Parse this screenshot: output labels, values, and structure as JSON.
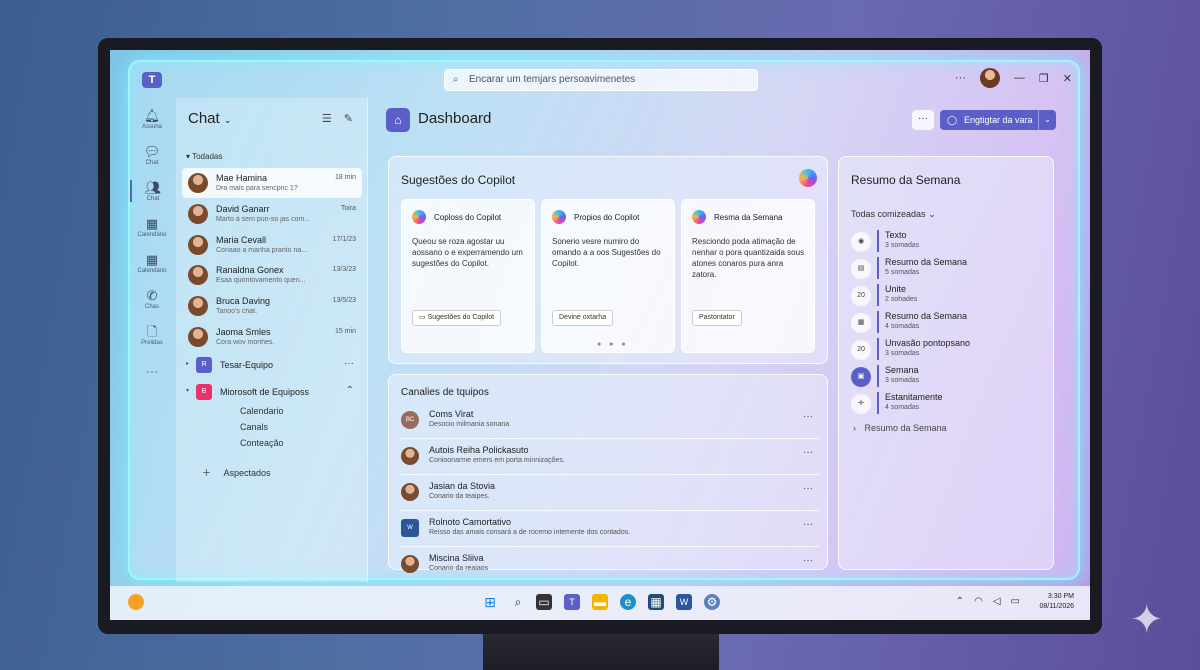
{
  "titlebar": {
    "search_placeholder": "Encarar um temjars persoavimenetes",
    "more_label": "···",
    "window_controls": [
      "minimize-icon",
      "restore-icon",
      "close-icon"
    ]
  },
  "rail": [
    {
      "label": "Assuna",
      "icon": "bell-icon"
    },
    {
      "label": "Chat",
      "icon": "chat-icon"
    },
    {
      "label": "Chat",
      "icon": "teams-icon",
      "active": true
    },
    {
      "label": "Calendário",
      "icon": "calendar-icon"
    },
    {
      "label": "Calendário",
      "icon": "calendar-icon"
    },
    {
      "label": "Chas",
      "icon": "phone-icon"
    },
    {
      "label": "Prelidas",
      "icon": "file-icon"
    }
  ],
  "chat": {
    "title": "Chat",
    "section": "Todadas",
    "items": [
      {
        "name": "Mae Hamina",
        "preview": "Dra mals para sencpnc 1?",
        "time": "18 min"
      },
      {
        "name": "David Ganarr",
        "preview": "Marto à sem pun-so jas com...",
        "time": "Toira"
      },
      {
        "name": "Maria Cevall",
        "preview": "Conaao a manha pranto na...",
        "time": "17/1/23"
      },
      {
        "name": "Ranaldna Gonex",
        "preview": "Esaa quontovamento quen...",
        "time": "13/3/23"
      },
      {
        "name": "Bruca Daving",
        "preview": "Tanoo's chat.",
        "time": "13/5/23"
      },
      {
        "name": "Jaoma Smles",
        "preview": "Cora wov monhes.",
        "time": "15 min"
      }
    ],
    "teams": [
      {
        "initial": "R",
        "name": "Tesar-Equipo",
        "color": "#5b5fc7"
      },
      {
        "initial": "B",
        "name": "Miorosoft de Equiposs",
        "color": "#e8336a"
      }
    ],
    "sub_items": [
      "Calendario",
      "Canals",
      "Conteação"
    ],
    "add_label": "Aspectados"
  },
  "dashboard": {
    "title": "Dashboard",
    "meet_label": "Engtigtar da vara",
    "copilot": {
      "title": "Sugestões do Copilot",
      "cards": [
        {
          "title": "Coploss do Copilot",
          "body": "Queou se roza agostar uu aossano o e experramendo um sugestões do Copilot.",
          "button": "Sugestões do Copilot"
        },
        {
          "title": "Propios do Copilot",
          "body": "Sonerio vesre numiro do omando a a oos Sugestões do Copilot.",
          "button": "Devine oxtarha"
        },
        {
          "title": "Resma da Semana",
          "body": "Resciondo poda atimação de nenhar o pora quantizaida sous atones conaros pura anra zatora.",
          "button": "Pastontator"
        }
      ],
      "pager": "● ● ●"
    },
    "channels": {
      "title": "Canalies de tquipos",
      "items": [
        {
          "name": "Coms Virat",
          "preview": "Desocio milmania sonana",
          "initials": "BC"
        },
        {
          "name": "Autois Reiha Polickasuto",
          "preview": "Conioonarme emers em porta minnizações.",
          "initials": ""
        },
        {
          "name": "Jasian da Stovia",
          "preview": "Conario da teaipes.",
          "initials": ""
        },
        {
          "name": "Rolnoto Camortativo",
          "preview": "Reisso das amais consará a de rocemo intemente dos contados.",
          "initials": ""
        },
        {
          "name": "Miscina Sliiva",
          "preview": "Conario da reaiaos",
          "initials": ""
        }
      ]
    },
    "summary": {
      "title": "Resumo da Semana",
      "filter": "Todas comizeadas",
      "items": [
        {
          "name": "Texto",
          "count": "3 somadas",
          "icon": "eye-icon",
          "badge": ""
        },
        {
          "name": "Resumo da Semana",
          "count": "5 somadas",
          "icon": "document-icon",
          "badge": ""
        },
        {
          "name": "Unite",
          "count": "2 sohades",
          "icon": "",
          "badge": "20"
        },
        {
          "name": "Resumo da Semana",
          "count": "4 somadas",
          "icon": "calendar-icon",
          "badge": ""
        },
        {
          "name": "Unvasão pontopsano",
          "count": "3 somadas",
          "icon": "",
          "badge": "20"
        },
        {
          "name": "Semana",
          "count": "3 somadas",
          "icon": "clipboard-icon",
          "badge": ""
        },
        {
          "name": "Estanitamente",
          "count": "4 somadas",
          "icon": "plus-icon",
          "badge": ""
        }
      ],
      "footer": "Resumo da Semana"
    }
  },
  "taskbar": {
    "time": "3:30 PM",
    "date": "08/11/2026"
  }
}
